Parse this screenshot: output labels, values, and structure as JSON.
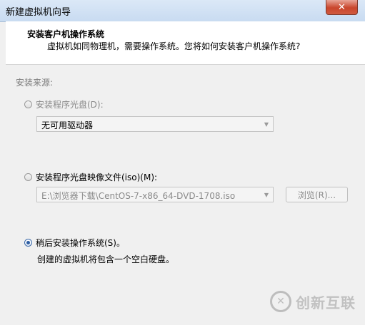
{
  "window": {
    "title": "新建虚拟机向导",
    "close_glyph": "✕"
  },
  "header": {
    "title": "安装客户机操作系统",
    "subtitle": "虚拟机如同物理机，需要操作系统。您将如何安装客户机操作系统?"
  },
  "install_source": {
    "label": "安装来源:",
    "disc_option": {
      "label": "安装程序光盘(D):",
      "selected": false,
      "enabled": false
    },
    "disc_drive": {
      "value": "无可用驱动器",
      "enabled": false
    },
    "iso_option": {
      "label": "安装程序光盘映像文件(iso)(M):",
      "selected": false,
      "enabled": true
    },
    "iso_path": {
      "value": "E:\\浏览器下载\\CentOS-7-x86_64-DVD-1708.iso",
      "enabled": false
    },
    "browse_button": {
      "label": "浏览(R)...",
      "enabled": false
    },
    "later_option": {
      "label": "稍后安装操作系统(S)。",
      "selected": true,
      "enabled": true
    },
    "later_note": "创建的虚拟机将包含一个空白硬盘。"
  },
  "watermark": {
    "text": "创新互联",
    "logo_glyph": "✕"
  }
}
